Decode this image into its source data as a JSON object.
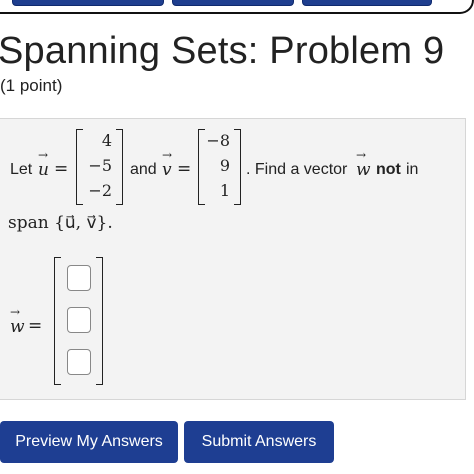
{
  "header": {
    "title": "Spanning Sets: Problem 9",
    "points": "(1 point)"
  },
  "problem": {
    "let": "Let",
    "u_symbol": "u",
    "v_symbol": "v",
    "w_symbol": "w",
    "equals": "=",
    "and": "and",
    "u_vector": [
      "4",
      "−5",
      "−2"
    ],
    "v_vector": [
      "−8",
      "9",
      "1"
    ],
    "find_prefix": ". Find a vector",
    "not_word": "not",
    "in_word": "in",
    "span_text": "span {u⃗, v⃗}."
  },
  "answer": {
    "inputs": [
      "",
      "",
      ""
    ]
  },
  "buttons": {
    "preview": "Preview My Answers",
    "submit": "Submit Answers"
  },
  "colors": {
    "button_blue": "#1e3e92",
    "panel_bg": "#f3f3f3"
  }
}
